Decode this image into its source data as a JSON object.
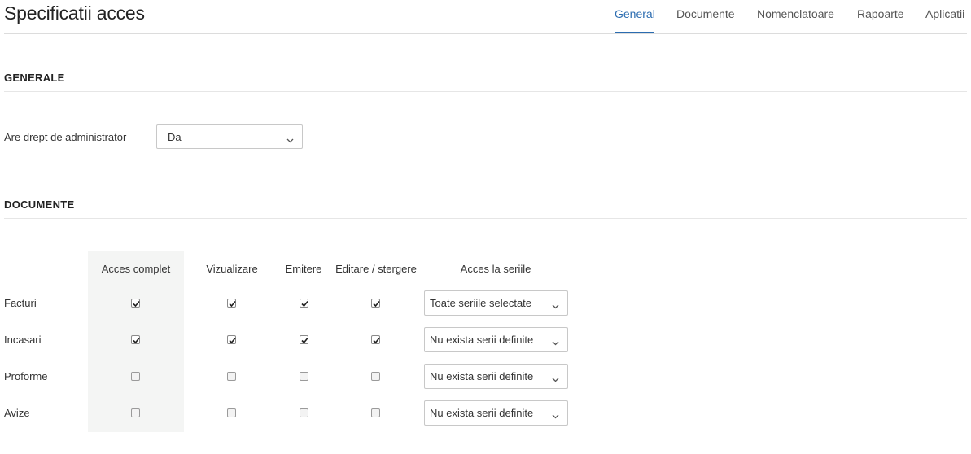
{
  "header": {
    "title": "Specificatii acces",
    "tabs": [
      {
        "label": "General",
        "active": true
      },
      {
        "label": "Documente",
        "active": false
      },
      {
        "label": "Nomenclatoare",
        "active": false
      },
      {
        "label": "Rapoarte",
        "active": false
      },
      {
        "label": "Aplicatii",
        "active": false
      }
    ]
  },
  "generale": {
    "heading": "GENERALE",
    "admin_label": "Are drept de administrator",
    "admin_value": "Da"
  },
  "documente": {
    "heading": "DOCUMENTE",
    "columns": [
      "Acces complet",
      "Vizualizare",
      "Emitere",
      "Editare / stergere",
      "Acces la seriile"
    ],
    "rows": [
      {
        "label": "Facturi",
        "acces_complet": true,
        "vizualizare": true,
        "emitere": true,
        "editare": true,
        "serii": "Toate seriile selectate"
      },
      {
        "label": "Incasari",
        "acces_complet": true,
        "vizualizare": true,
        "emitere": true,
        "editare": true,
        "serii": "Nu exista serii definite"
      },
      {
        "label": "Proforme",
        "acces_complet": false,
        "vizualizare": false,
        "emitere": false,
        "editare": false,
        "serii": "Nu exista serii definite"
      },
      {
        "label": "Avize",
        "acces_complet": false,
        "vizualizare": false,
        "emitere": false,
        "editare": false,
        "serii": "Nu exista serii definite"
      }
    ]
  },
  "colors": {
    "accent": "#2b6cb0",
    "acces_column_bg": "#f4f5f4"
  }
}
